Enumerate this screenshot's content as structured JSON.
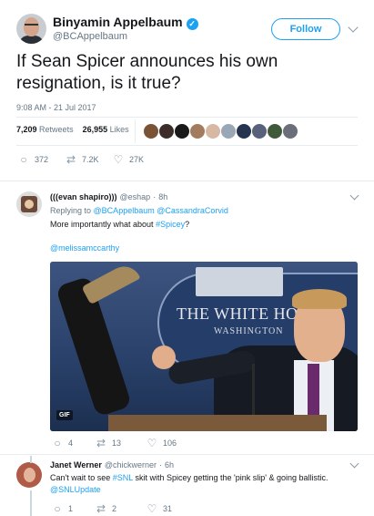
{
  "main_tweet": {
    "author_name": "Binyamin Appelbaum",
    "handle": "@BCAppelbaum",
    "verified": true,
    "follow_label": "Follow",
    "text": "If Sean Spicer announces his own resignation, is it true?",
    "timestamp": "9:08 AM - 21 Jul 2017",
    "retweets_count": "7,209",
    "retweets_label": "Retweets",
    "likes_count": "26,955",
    "likes_label": "Likes",
    "actions": {
      "replies": "372",
      "retweets": "7.2K",
      "likes": "27K"
    },
    "liker_avatar_colors": [
      "#7a5236",
      "#3b2e2a",
      "#1a1a1a",
      "#a37b5f",
      "#d6b8a3",
      "#9aa7b5",
      "#25354f",
      "#58627a",
      "#3f5a3a",
      "#6a6f7a"
    ]
  },
  "reply_1": {
    "author_name": "(((evan shapiro)))",
    "handle": "@eshap",
    "age": "8h",
    "replying_to_prefix": "Replying to",
    "replying_to_1": "@BCAppelbaum",
    "replying_to_2": "@CassandraCorvid",
    "text_prefix": "More importantly what about ",
    "hashtag": "#Spicey",
    "text_suffix": "?",
    "mention": "@melissamccarthy",
    "gif_badge": "GIF",
    "gif_sign_text": "THE WHITE HO",
    "gif_sign_sub": "WASHINGTON",
    "actions": {
      "replies": "4",
      "retweets": "13",
      "likes": "106"
    }
  },
  "reply_2": {
    "author_name": "Janet Werner",
    "handle": "@chickwerner",
    "age": "6h",
    "text_prefix": "Can't wait to see ",
    "hashtag": "#SNL",
    "text_suffix": " skit with Spicey getting the 'pink slip' & going ballistic.",
    "mention": "@SNLUpdate",
    "actions": {
      "replies": "1",
      "retweets": "2",
      "likes": "31"
    }
  },
  "colors": {
    "link": "#1da1f2",
    "meta": "#657786",
    "divider": "#e6ecf0"
  },
  "icons": [
    "verified-badge-icon",
    "chevron-down-icon",
    "reply-icon",
    "retweet-icon",
    "like-icon"
  ]
}
